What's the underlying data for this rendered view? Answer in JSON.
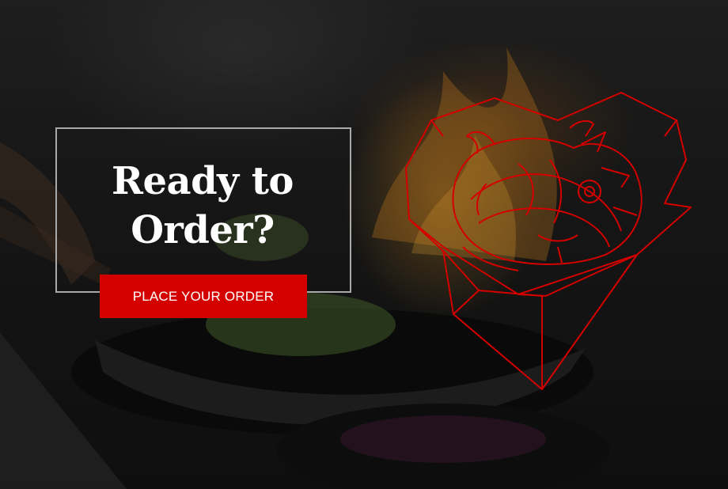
{
  "hero": {
    "background": "chef-cooking-wok-flames-photo",
    "heading": "Ready to Order?",
    "cta_label": "PLACE YOUR ORDER",
    "accent_color": "#d40000",
    "frame_color": "#a9a9a9",
    "logo": "heart-dragon-outline-logo"
  }
}
